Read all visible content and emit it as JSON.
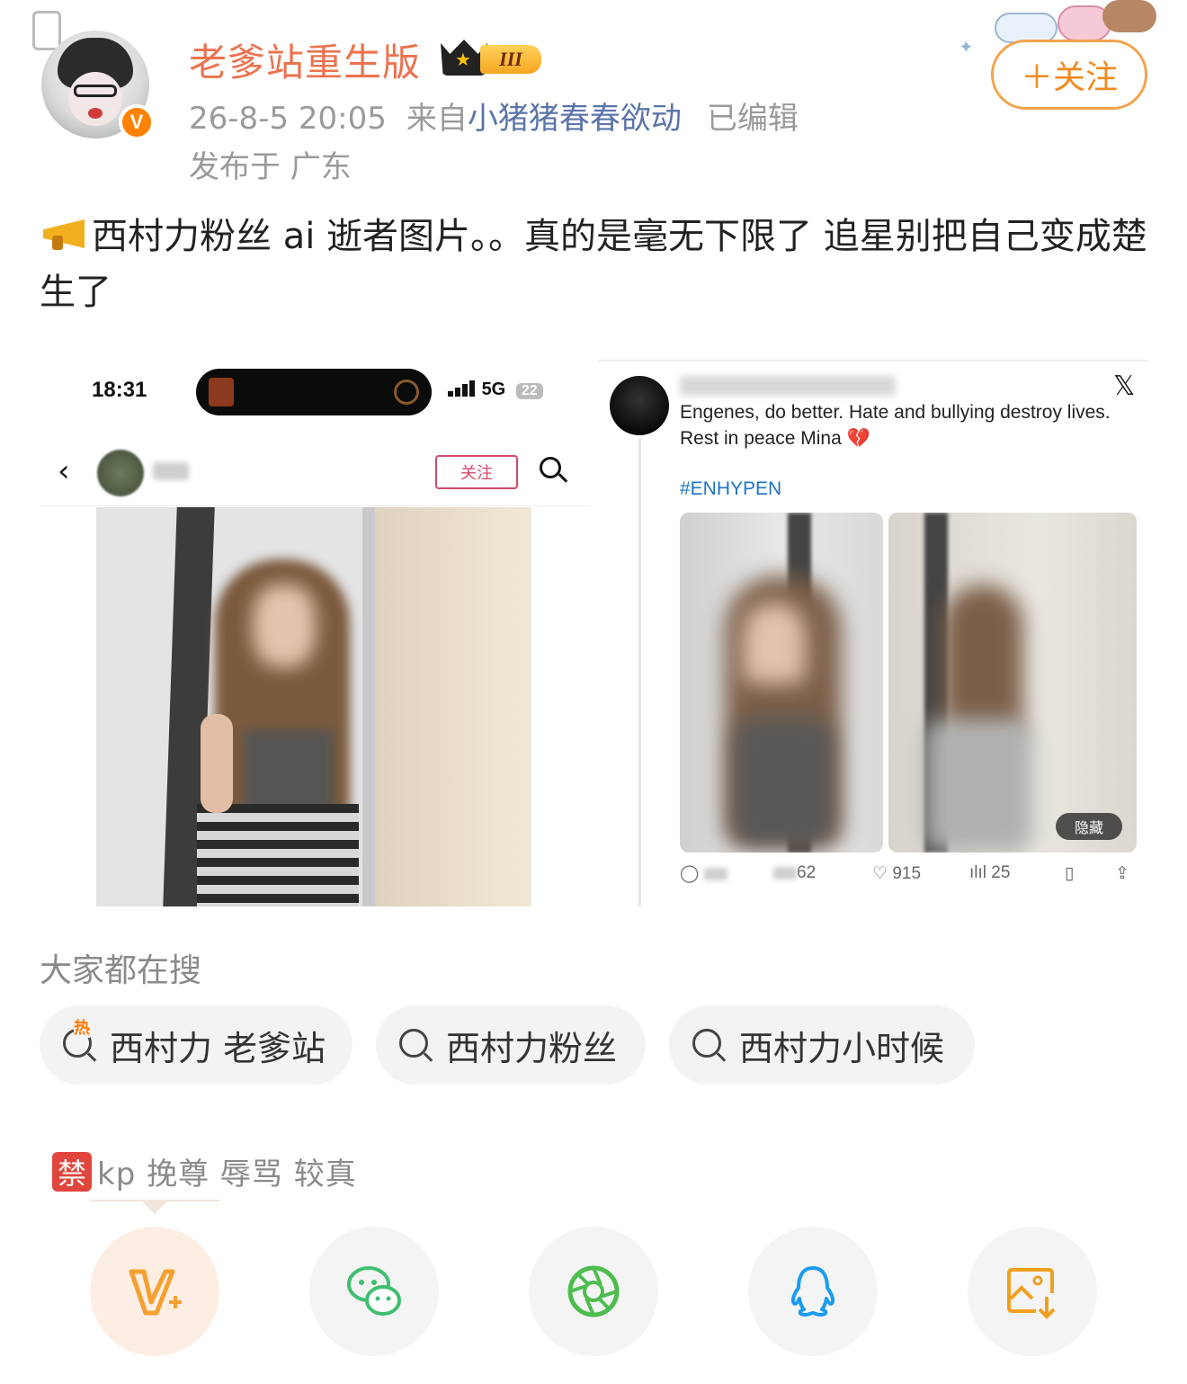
{
  "post": {
    "username": "老爹站重生版",
    "vip_level": "III",
    "verified_badge": "V",
    "time": "26-8-5 20:05",
    "source_prefix": "来自",
    "source": "小猪猪春春欲动",
    "edited": "已编辑",
    "location": "发布于 广东",
    "follow_button": "＋关注",
    "text": "西村力粉丝 ai 逝者图片。。真的是毫无下限了 追星别把自己变成楚生了"
  },
  "left_image": {
    "status_time": "18:31",
    "network": "5G",
    "battery": "22",
    "follow": "关注"
  },
  "right_image": {
    "logo": "𝕏",
    "tweet_text": "Engenes, do better. Hate and bullying destroy lives. Rest in peace Mina",
    "heart_emoji": "💔",
    "hashtag": "#ENHYPEN",
    "photo_chip": "隐藏",
    "retweets": "62",
    "likes": "915",
    "views": "25"
  },
  "search": {
    "title": "大家都在搜",
    "hot_mark": "热",
    "chips": [
      "西村力 老爹站",
      "西村力粉丝",
      "西村力小时候"
    ]
  },
  "rules": {
    "ban_icon": "禁",
    "text": "kp 挽尊 辱骂 较真"
  },
  "share": {
    "icons": [
      "weibo-v-plus-icon",
      "wechat-icon",
      "moments-icon",
      "qq-icon",
      "save-image-icon"
    ],
    "colors": {
      "orange": "#f5a030",
      "green": "#3fbf6f",
      "lime": "#4dbd4d",
      "blue": "#1a9cf0",
      "yellow": "#f0a020"
    }
  }
}
